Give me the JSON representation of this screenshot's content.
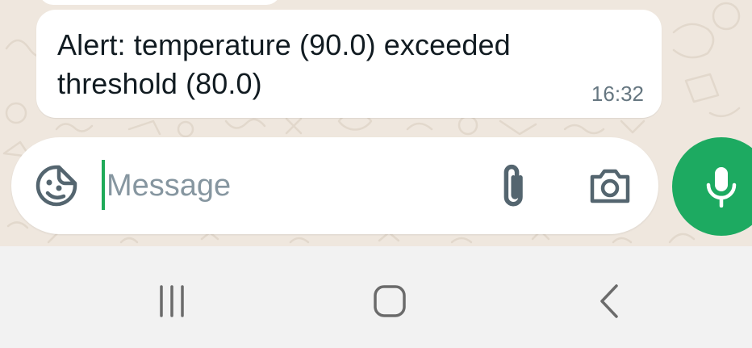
{
  "chat": {
    "message": {
      "text": "Alert: temperature (90.0) exceeded threshold (80.0)",
      "time": "16:32"
    }
  },
  "composer": {
    "placeholder": "Message",
    "value": "",
    "icons": {
      "emoji": "sticker-emoji-icon",
      "attach": "paperclip-icon",
      "camera": "camera-icon",
      "mic": "microphone-icon"
    }
  },
  "nav": {
    "icons": {
      "recents": "recent-apps-icon",
      "home": "home-icon",
      "back": "back-icon"
    }
  },
  "colors": {
    "accent": "#1daa61",
    "chat_background": "#efe7de",
    "bubble": "#ffffff",
    "timestamp": "#667781",
    "nav_background": "#f2f2f2"
  }
}
